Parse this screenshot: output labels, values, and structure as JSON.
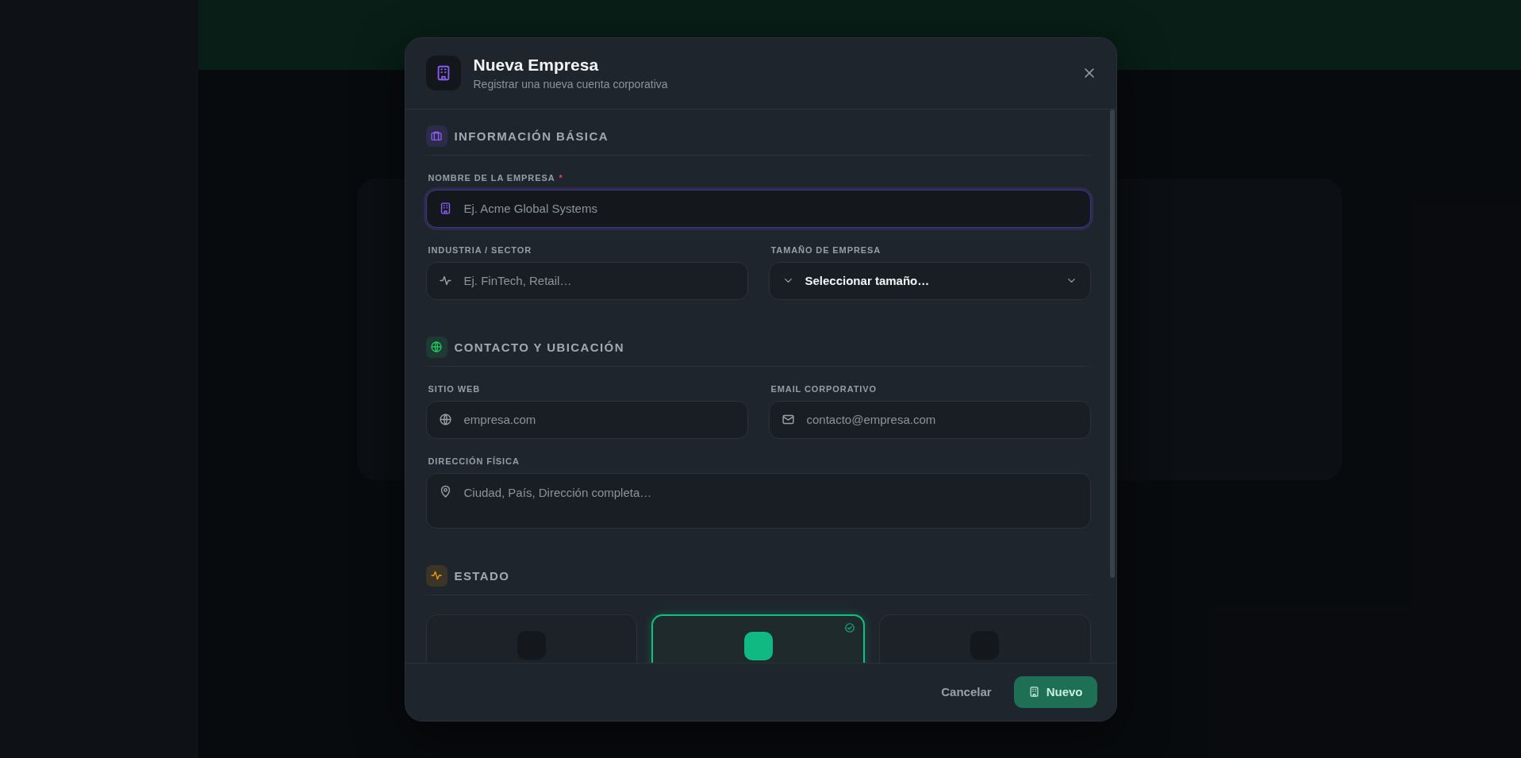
{
  "dialog": {
    "title": "Nueva Empresa",
    "subtitle": "Registrar una nueva cuenta corporativa"
  },
  "sections": [
    {
      "kind": "basic",
      "title": "INFORMACIÓN BÁSICA",
      "color": "#8b5cf6",
      "fields": [
        {
          "kind": "company",
          "label": "NOMBRE DE LA EMPRESA",
          "required_mark": "*",
          "placeholder": "Ej. Acme Global Systems",
          "focused": true
        },
        {
          "kind": "industry",
          "label": "INDUSTRIA / SECTOR",
          "placeholder": "Ej. FinTech, Retail…",
          "focused": false
        },
        {
          "kind": "size",
          "label": "TAMAÑO DE EMPRESA",
          "value": "Seleccionar tamaño…",
          "focused": false
        }
      ]
    },
    {
      "kind": "contact",
      "title": "CONTACTO Y UBICACIÓN",
      "color": "#22c55e",
      "fields": [
        {
          "kind": "website",
          "label": "SITIO WEB",
          "placeholder": "empresa.com",
          "focused": false
        },
        {
          "kind": "email",
          "label": "EMAIL CORPORATIVO",
          "placeholder": "contacto@empresa.com",
          "focused": false
        },
        {
          "kind": "address",
          "label": "DIRECCIÓN FÍSICA",
          "placeholder": "Ciudad, País, Dirección completa…",
          "focused": false
        }
      ]
    },
    {
      "kind": "status",
      "title": "ESTADO",
      "color": "#f59e0b",
      "options": [
        {
          "selected": false
        },
        {
          "selected": true
        },
        {
          "selected": false
        }
      ]
    }
  ],
  "footer": {
    "cancel": "Cancelar",
    "submit": "Nuevo"
  }
}
